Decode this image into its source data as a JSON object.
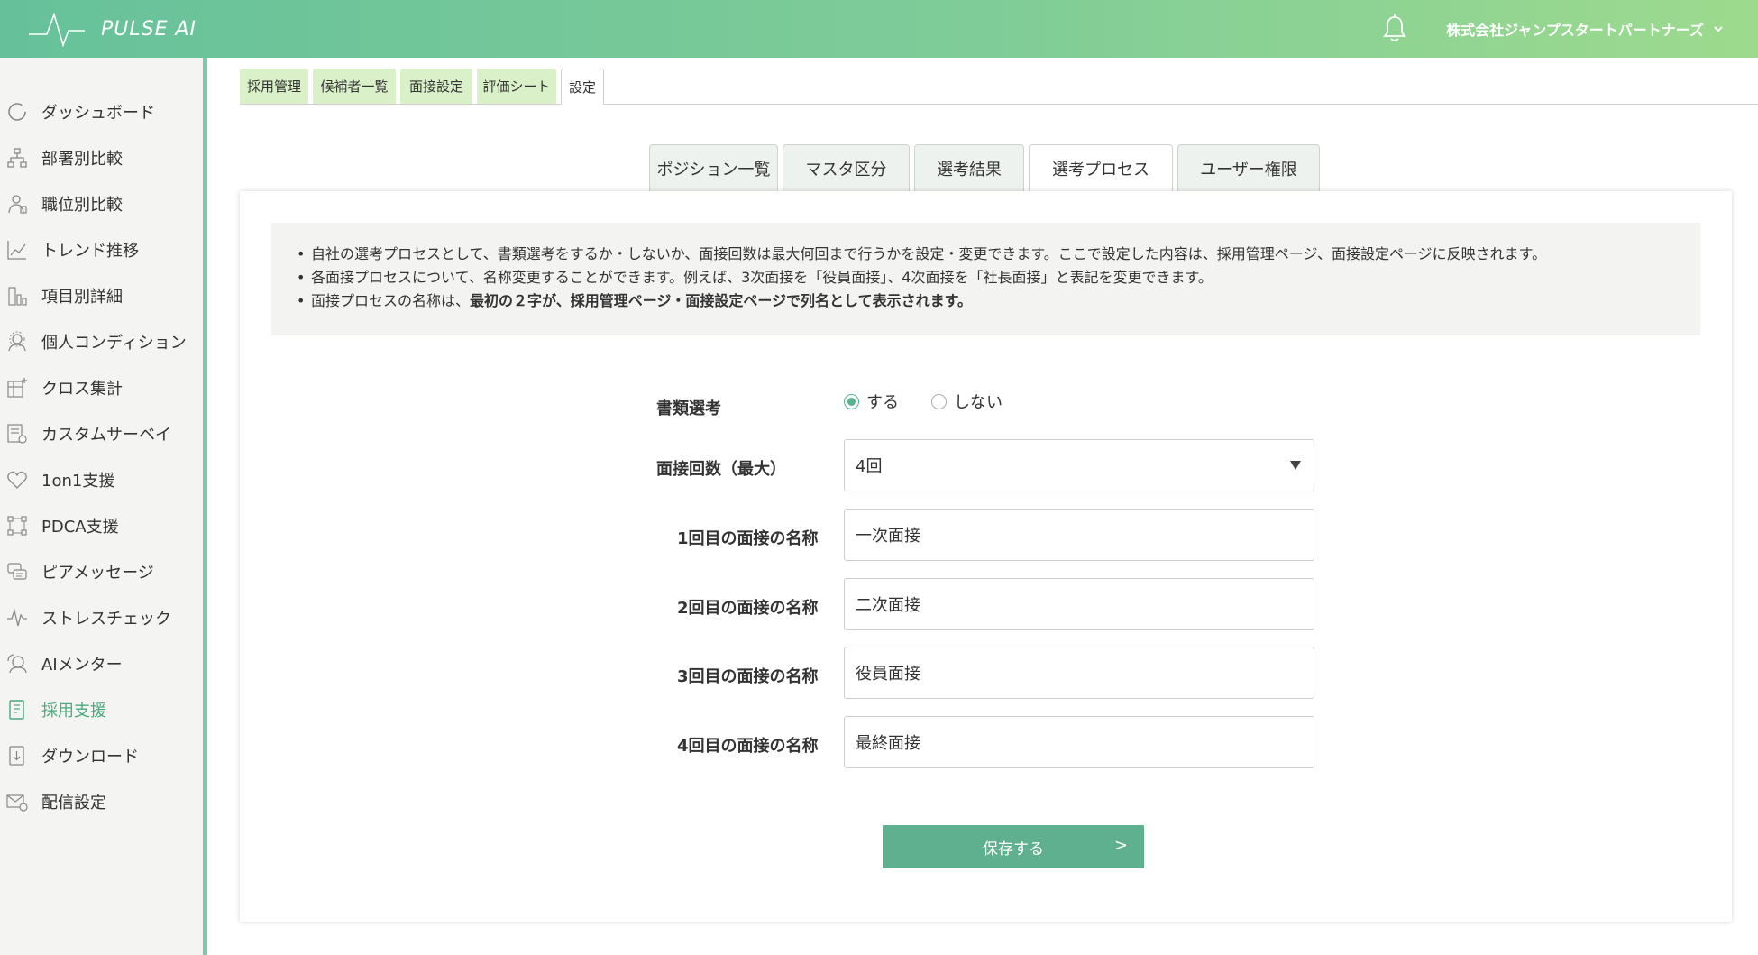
{
  "app": {
    "brand": "PULSE AI"
  },
  "header": {
    "company": "株式会社ジャンプスタートパートナーズ"
  },
  "sidebar": {
    "items": [
      {
        "label": "ダッシュボード",
        "icon": "dashboard-circle-icon"
      },
      {
        "label": "部署別比較",
        "icon": "org-chart-icon"
      },
      {
        "label": "職位別比較",
        "icon": "person-rank-icon"
      },
      {
        "label": "トレンド推移",
        "icon": "trend-chart-icon"
      },
      {
        "label": "項目別詳細",
        "icon": "bar-detail-icon"
      },
      {
        "label": "個人コンディション",
        "icon": "person-condition-icon"
      },
      {
        "label": "クロス集計",
        "icon": "cross-tab-icon"
      },
      {
        "label": "カスタムサーベイ",
        "icon": "survey-icon"
      },
      {
        "label": "1on1支援",
        "icon": "heart-hand-icon"
      },
      {
        "label": "PDCA支援",
        "icon": "cycle-icon"
      },
      {
        "label": "ピアメッセージ",
        "icon": "message-icon"
      },
      {
        "label": "ストレスチェック",
        "icon": "stress-wave-icon"
      },
      {
        "label": "AIメンター",
        "icon": "ai-mentor-icon"
      },
      {
        "label": "採用支援",
        "icon": "recruit-doc-icon",
        "active": true
      },
      {
        "label": "ダウンロード",
        "icon": "download-icon"
      },
      {
        "label": "配信設定",
        "icon": "mail-settings-icon"
      }
    ],
    "active_color": "#4aa97e"
  },
  "top_tabs": [
    {
      "label": "採用管理"
    },
    {
      "label": "候補者一覧"
    },
    {
      "label": "面接設定"
    },
    {
      "label": "評価シート"
    },
    {
      "label": "設定",
      "active": true
    }
  ],
  "sub_tabs": [
    {
      "label": "ポジション一覧"
    },
    {
      "label": "マスタ区分"
    },
    {
      "label": "選考結果"
    },
    {
      "label": "選考プロセス",
      "active": true
    },
    {
      "label": "ユーザー権限"
    }
  ],
  "notice": {
    "line1": "自社の選考プロセスとして、書類選考をするか・しないか、面接回数は最大何回まで行うかを設定・変更できます。ここで設定した内容は、採用管理ページ、面接設定ページに反映されます。",
    "line2": "各面接プロセスについて、名称変更することができます。例えば、3次面接を「役員面接」、4次面接を「社長面接」と表記を変更できます。",
    "line3_prefix": "面接プロセスの名称は、",
    "line3_bold": "最初の２字が、採用管理ページ・面接設定ページで列名として表示されます。"
  },
  "form": {
    "document_screening": {
      "label": "書類選考",
      "options": [
        "する",
        "しない"
      ],
      "selected": "する"
    },
    "interview_count": {
      "label": "面接回数（最大）",
      "value": "4回"
    },
    "interviews": [
      {
        "label": "1回目の面接の名称",
        "value": "一次面接"
      },
      {
        "label": "2回目の面接の名称",
        "value": "二次面接"
      },
      {
        "label": "3回目の面接の名称",
        "value": "役員面接"
      },
      {
        "label": "4回目の面接の名称",
        "value": "最終面接"
      }
    ],
    "save_label": "保存する",
    "save_arrow": ">"
  },
  "colors": {
    "header_start": "#66c19a",
    "header_end": "#9dda8e",
    "accent": "#5fb08f",
    "top_tab_bg": "#d9f0c8"
  }
}
